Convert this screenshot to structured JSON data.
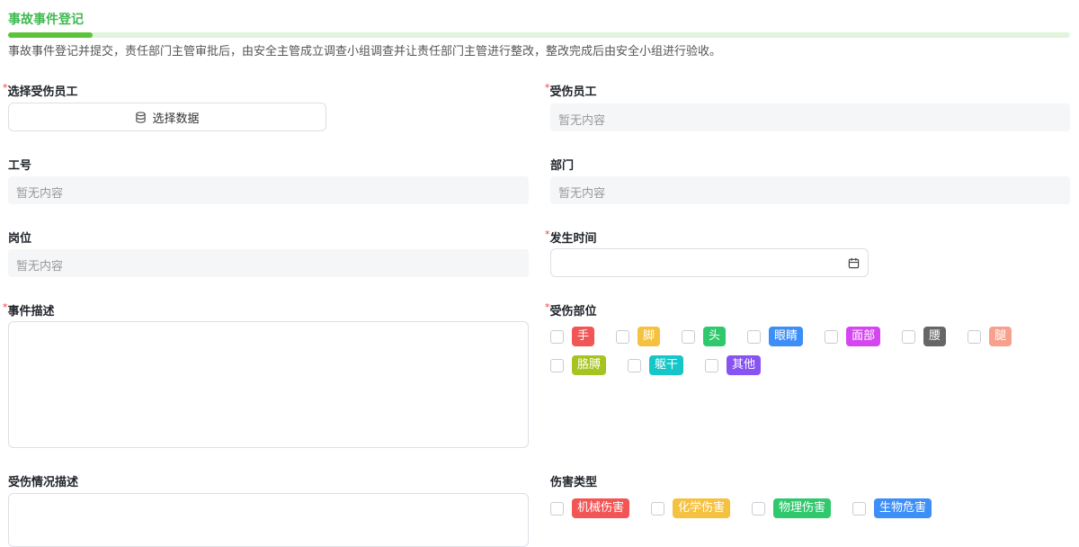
{
  "header": {
    "title": "事故事件登记",
    "progress_percent": 8,
    "description": "事故事件登记并提交，责任部门主管审批后，由安全主管成立调查小组调查并让责任部门主管进行整改，整改完成后由安全小组进行验收。"
  },
  "form": {
    "required_mark": "*",
    "select_employee": {
      "label": "选择受伤员工",
      "button": "选择数据"
    },
    "injured_employee": {
      "label": "受伤员工",
      "value": "暂无内容"
    },
    "employee_id": {
      "label": "工号",
      "value": "暂无内容"
    },
    "department": {
      "label": "部门",
      "value": "暂无内容"
    },
    "position": {
      "label": "岗位",
      "value": "暂无内容"
    },
    "occur_time": {
      "label": "发生时间",
      "value": ""
    },
    "event_desc": {
      "label": "事件描述",
      "value": ""
    },
    "injury_desc": {
      "label": "受伤情况描述",
      "value": ""
    },
    "body_parts": {
      "label": "受伤部位",
      "options": [
        {
          "label": "手",
          "color": "#f25555"
        },
        {
          "label": "脚",
          "color": "#f5c140"
        },
        {
          "label": "头",
          "color": "#2fc86c"
        },
        {
          "label": "眼睛",
          "color": "#3d8ef6"
        },
        {
          "label": "面部",
          "color": "#d446f0"
        },
        {
          "label": "腰",
          "color": "#666666"
        },
        {
          "label": "腿",
          "color": "#f8a08e"
        },
        {
          "label": "胳膊",
          "color": "#a6c420"
        },
        {
          "label": "躯干",
          "color": "#16c6c8"
        },
        {
          "label": "其他",
          "color": "#8753f2"
        }
      ]
    },
    "harm_types": {
      "label": "伤害类型",
      "options": [
        {
          "label": "机械伤害",
          "color": "#f25555"
        },
        {
          "label": "化学伤害",
          "color": "#f5c140"
        },
        {
          "label": "物理伤害",
          "color": "#2fc86c"
        },
        {
          "label": "生物危害",
          "color": "#3d8ef6"
        }
      ]
    }
  }
}
